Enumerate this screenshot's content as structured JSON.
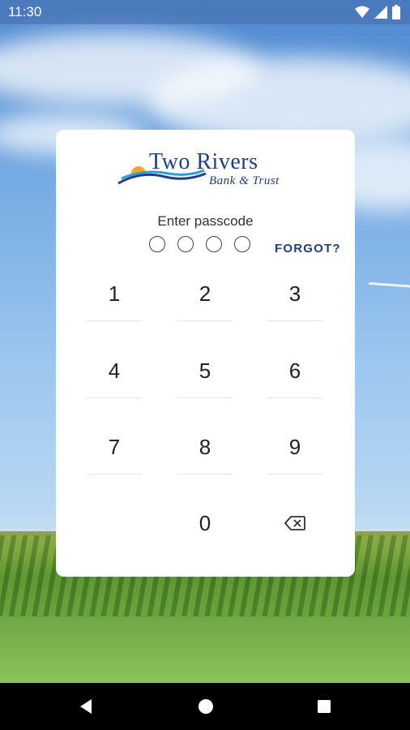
{
  "status_bar": {
    "time": "11:30",
    "icons": [
      "wifi-icon",
      "cell-signal-icon",
      "battery-icon"
    ]
  },
  "bank": {
    "name": "Two Rivers",
    "tagline": "Bank & Trust",
    "brand_color": "#1e3e8c",
    "sun_color": "#f5a623",
    "wave_color": "#2a9fd8"
  },
  "passcode": {
    "prompt": "Enter passcode",
    "length": 4,
    "entered": 0,
    "forgot_label": "FORGOT?"
  },
  "keypad": {
    "keys": [
      "1",
      "2",
      "3",
      "4",
      "5",
      "6",
      "7",
      "8",
      "9",
      "",
      "0",
      "backspace"
    ],
    "backspace_icon": "backspace-icon"
  },
  "nav_bar": {
    "buttons": [
      "back-icon",
      "home-icon",
      "recents-icon"
    ]
  }
}
